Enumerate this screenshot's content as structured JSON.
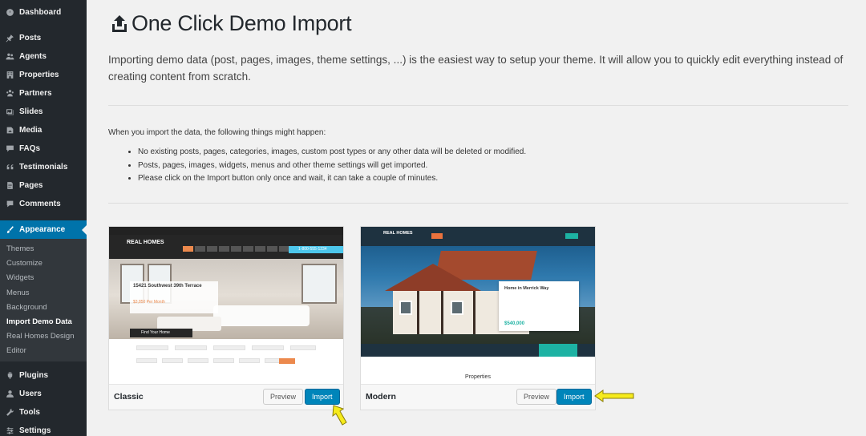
{
  "sidebar": {
    "top_items": [
      {
        "label": "Dashboard",
        "icon": "dashboard-icon"
      },
      {
        "label": "Posts",
        "icon": "pin-icon"
      },
      {
        "label": "Agents",
        "icon": "users-icon"
      },
      {
        "label": "Properties",
        "icon": "building-icon"
      },
      {
        "label": "Partners",
        "icon": "groups-icon"
      },
      {
        "label": "Slides",
        "icon": "images-icon"
      },
      {
        "label": "Media",
        "icon": "media-icon"
      },
      {
        "label": "FAQs",
        "icon": "faq-icon"
      },
      {
        "label": "Testimonials",
        "icon": "quote-icon"
      },
      {
        "label": "Pages",
        "icon": "page-icon"
      },
      {
        "label": "Comments",
        "icon": "comment-icon"
      }
    ],
    "active_item": {
      "label": "Appearance",
      "icon": "paintbrush-icon"
    },
    "submenu": [
      "Themes",
      "Customize",
      "Widgets",
      "Menus",
      "Background",
      "Import Demo Data",
      "Real Homes Design",
      "Editor"
    ],
    "bottom_items": [
      {
        "label": "Plugins",
        "icon": "plugin-icon"
      },
      {
        "label": "Users",
        "icon": "user-icon"
      },
      {
        "label": "Tools",
        "icon": "wrench-icon"
      },
      {
        "label": "Settings",
        "icon": "settings-icon"
      }
    ]
  },
  "main": {
    "title": "One Click Demo Import",
    "title_icon": "upload-icon",
    "intro": "Importing demo data (post, pages, images, theme settings, ...) is the easiest way to setup your theme. It will allow you to quickly edit everything instead of creating content from scratch.",
    "info_heading": "When you import the data, the following things might happen:",
    "info_items": [
      "No existing posts, pages, categories, images, custom post types or any other data will be deleted or modified.",
      "Posts, pages, images, widgets, menus and other theme settings will get imported.",
      "Please click on the Import button only once and wait, it can take a couple of minutes."
    ]
  },
  "demos": [
    {
      "name": "Classic",
      "preview_label": "Preview",
      "import_label": "Import",
      "thumb": {
        "logo": "REAL HOMES",
        "phone": "1-800-555-1234",
        "property_title": "15421 Southwest 39th Terrace",
        "property_price": "$3,850 Per Month",
        "search_label": "Find Your Home"
      }
    },
    {
      "name": "Modern",
      "preview_label": "Preview",
      "import_label": "Import",
      "thumb": {
        "logo": "REAL HOMES",
        "property_title": "Home in Merrick Way",
        "property_price": "$540,000",
        "section_title": "Properties"
      }
    }
  ],
  "colors": {
    "sidebar_bg": "#23282d",
    "active_blue": "#0073aa",
    "import_button": "#0085ba",
    "arrow_yellow": "#f6eb1c"
  }
}
